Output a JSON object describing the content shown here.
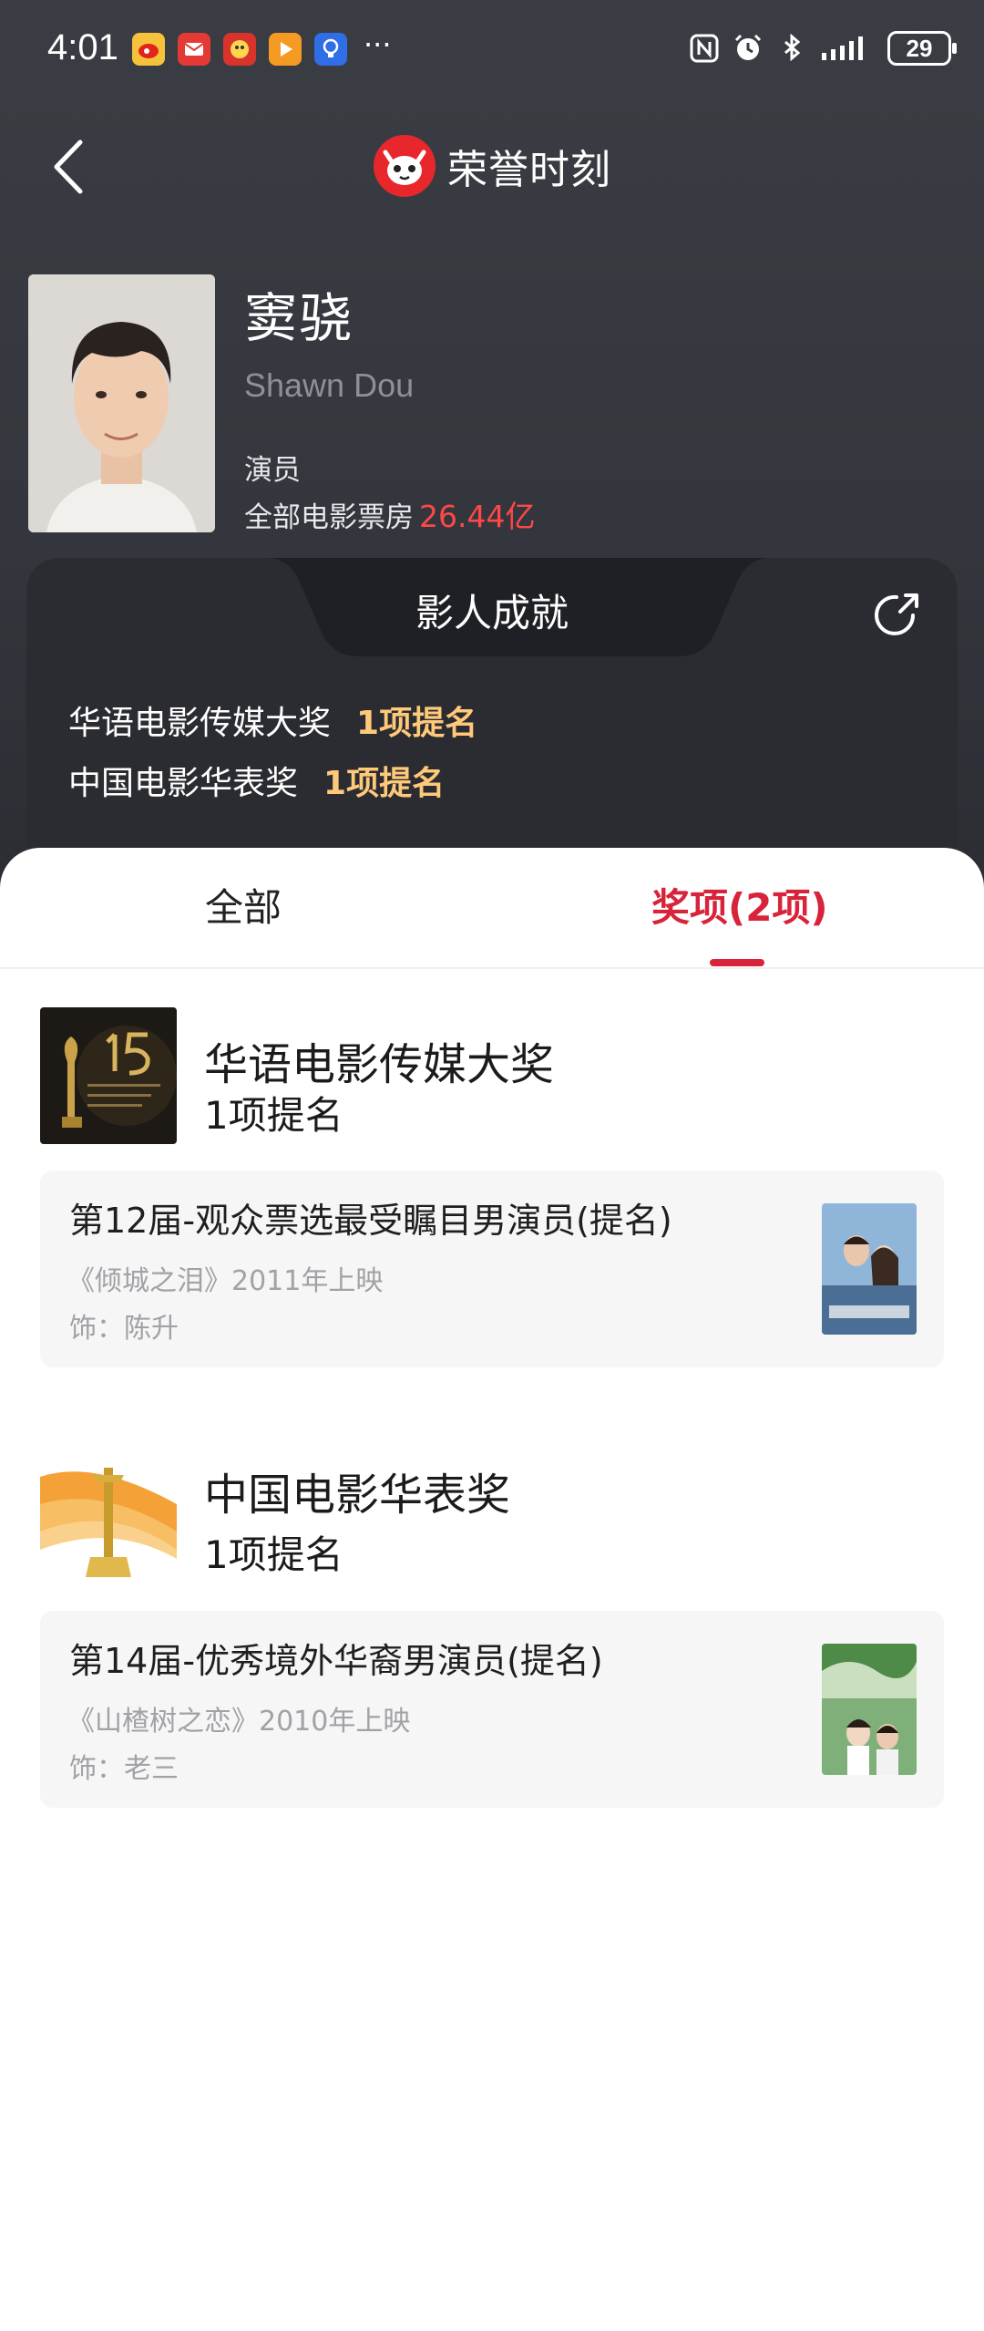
{
  "status_bar": {
    "time": "4:01",
    "more": "···",
    "battery": "29"
  },
  "nav": {
    "title": "荣誉时刻"
  },
  "profile": {
    "name_cn": "窦骁",
    "name_en": "Shawn Dou",
    "role": "演员",
    "box_office_label": "全部电影票房",
    "box_office_value": "26.44亿"
  },
  "achievements": {
    "title": "影人成就",
    "rows": [
      {
        "award": "华语电影传媒大奖",
        "value": "1项提名"
      },
      {
        "award": "中国电影华表奖",
        "value": "1项提名"
      }
    ]
  },
  "tabs": {
    "all": "全部",
    "awards": "奖项(2项)"
  },
  "awards": [
    {
      "name": "华语电影传媒大奖",
      "count": "1项提名",
      "nomination": {
        "title": "第12届-观众票选最受瞩目男演员(提名)",
        "film": "《倾城之泪》2011年上映",
        "role": "饰：陈升"
      }
    },
    {
      "name": "中国电影华表奖",
      "count": "1项提名",
      "nomination": {
        "title": "第14届-优秀境外华裔男演员(提名)",
        "film": "《山楂树之恋》2010年上映",
        "role": "饰：老三"
      }
    }
  ],
  "colors": {
    "accent": "#d8243a",
    "box_office": "#ff4747",
    "achievement_value": "#ffc97a"
  }
}
